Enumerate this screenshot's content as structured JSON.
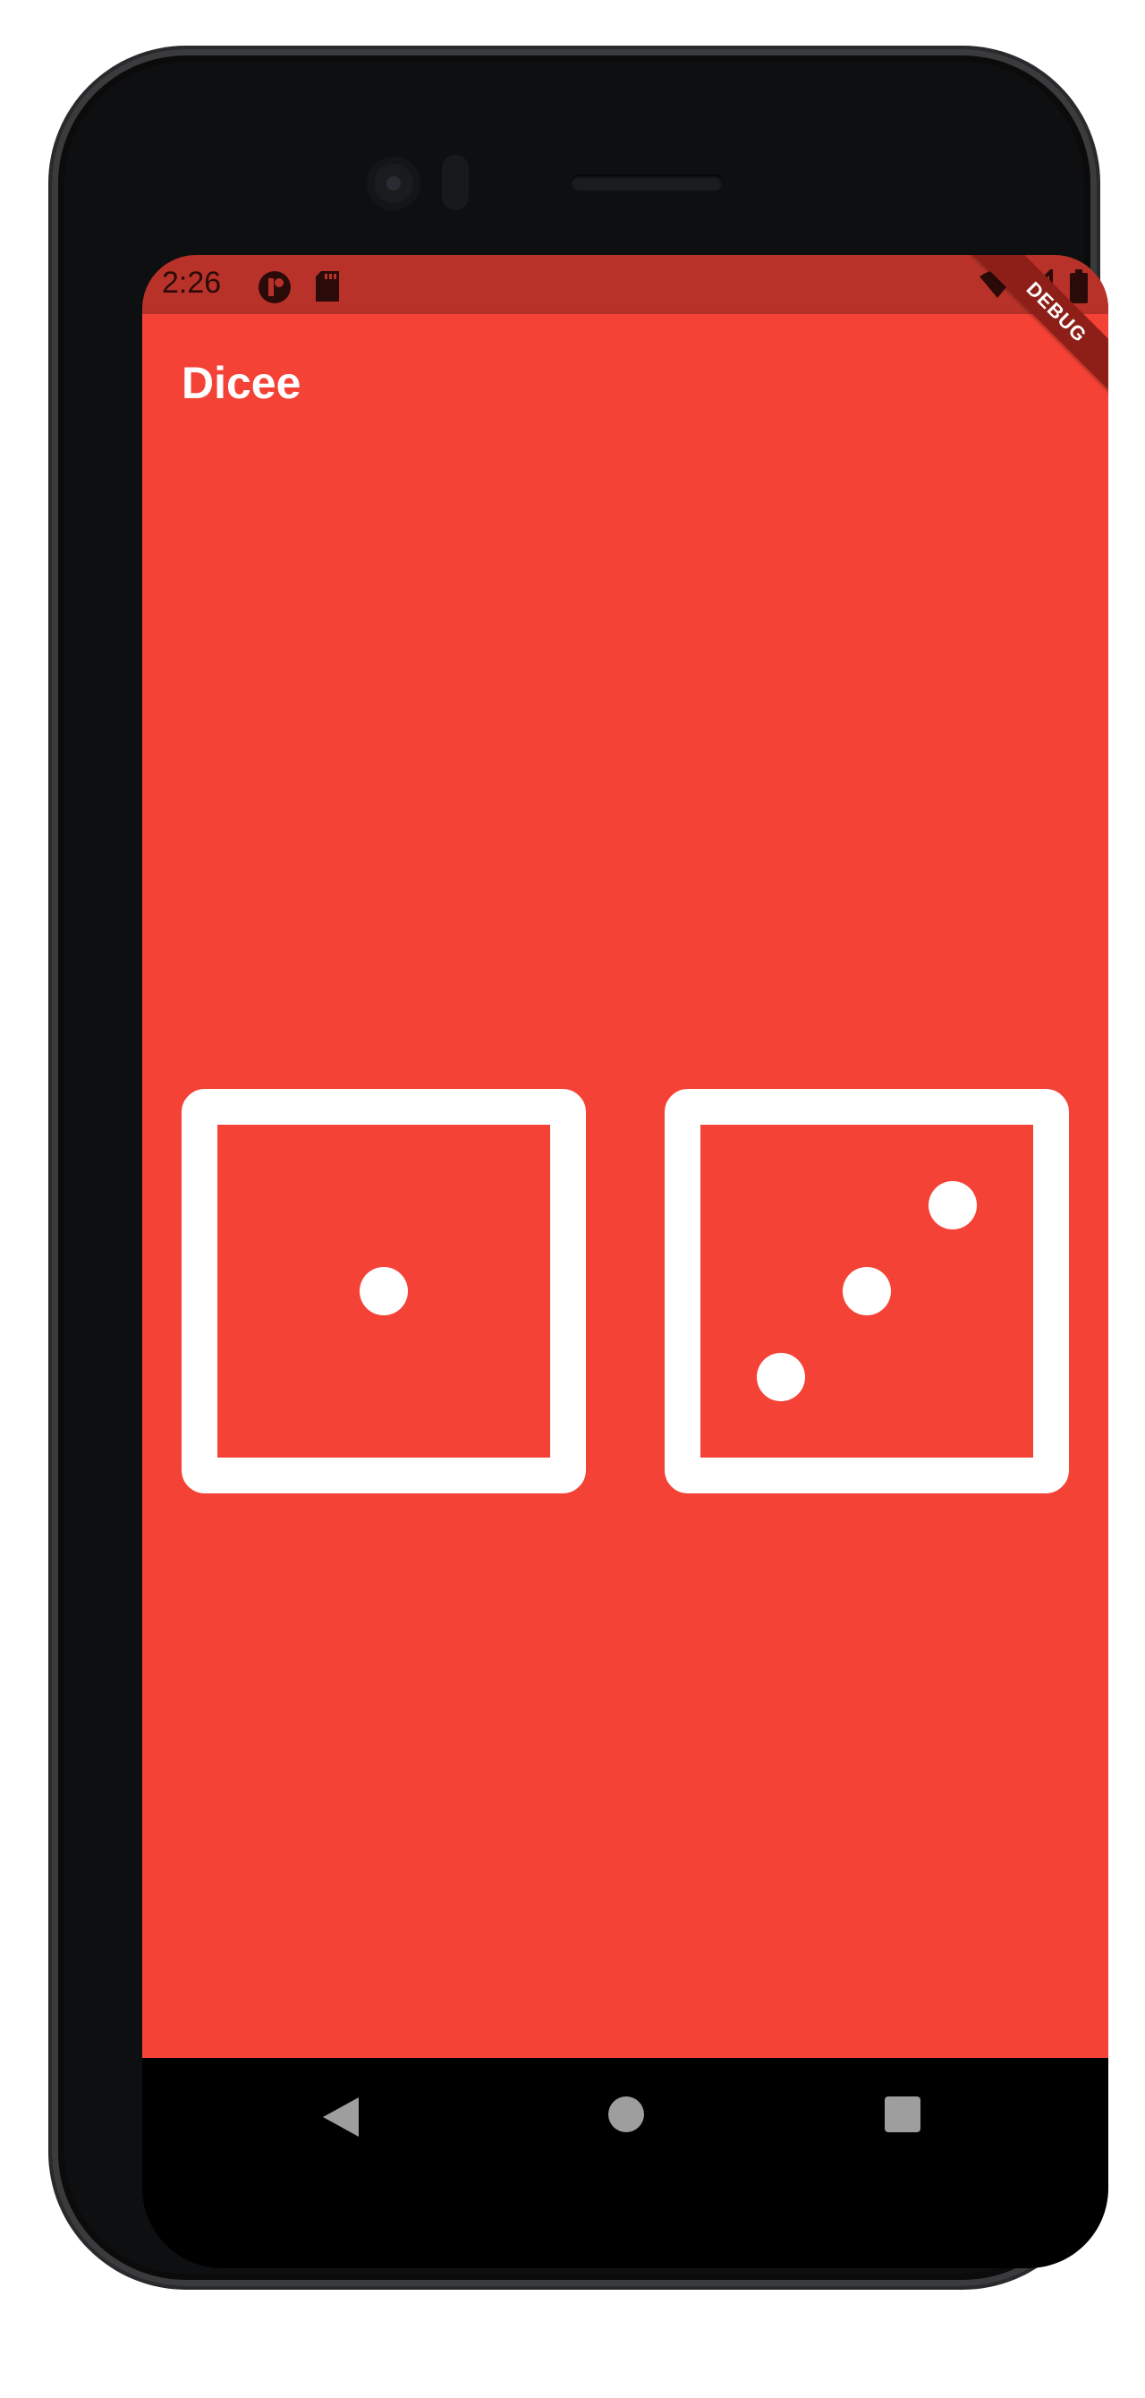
{
  "status_bar": {
    "time": "2:26",
    "left_icons": [
      "app-notification-icon",
      "sd-card-icon"
    ],
    "right_icons": [
      "wifi-icon",
      "cellular-signal-icon",
      "battery-icon"
    ]
  },
  "app_bar": {
    "title": "Dicee"
  },
  "debug_banner": "DEBUG",
  "dice": [
    {
      "name": "left-dice",
      "value": 1
    },
    {
      "name": "right-dice",
      "value": 3
    }
  ],
  "navigation": {
    "buttons": [
      "back-icon",
      "home-icon",
      "recents-icon"
    ]
  },
  "colors": {
    "primary": "#f44336",
    "status_bar": "#b93229",
    "dice_face": "#ffffff"
  }
}
